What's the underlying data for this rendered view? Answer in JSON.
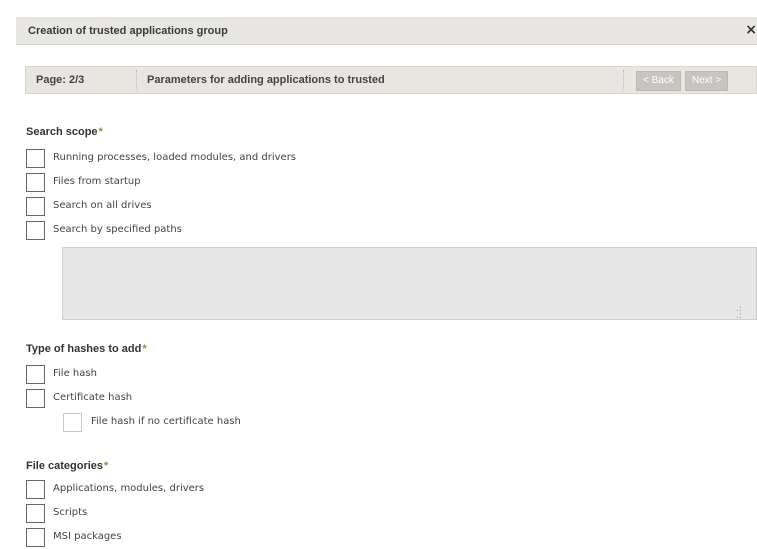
{
  "dialog": {
    "title": "Creation of trusted applications group",
    "close": "×"
  },
  "wizard": {
    "page_label": "Page: 2/3",
    "step_title": "Parameters for adding applications to trusted",
    "back_label": "< Back",
    "next_label": "Next >"
  },
  "search_scope": {
    "title": "Search scope",
    "required_mark": "*",
    "options": [
      {
        "label": "Running processes, loaded modules, and drivers",
        "checked": false
      },
      {
        "label": "Files from startup",
        "checked": false
      },
      {
        "label": "Search on all drives",
        "checked": false
      },
      {
        "label": "Search by specified paths",
        "checked": false
      }
    ],
    "paths_value": ""
  },
  "hash_types": {
    "title": "Type of hashes to add",
    "required_mark": "*",
    "options": [
      {
        "label": "File hash",
        "checked": false
      },
      {
        "label": "Certificate hash",
        "checked": false
      },
      {
        "label": "File hash if no certificate hash",
        "checked": false,
        "disabled": true
      }
    ]
  },
  "file_categories": {
    "title": "File categories",
    "required_mark": "*",
    "options": [
      {
        "label": "Applications, modules, drivers",
        "checked": false
      },
      {
        "label": "Scripts",
        "checked": false
      },
      {
        "label": "MSI packages",
        "checked": false
      }
    ]
  },
  "colors": {
    "required_mark": "#6aa827",
    "header_bg": "#e9e7e3",
    "disabled_button": "#c8c5c0"
  }
}
